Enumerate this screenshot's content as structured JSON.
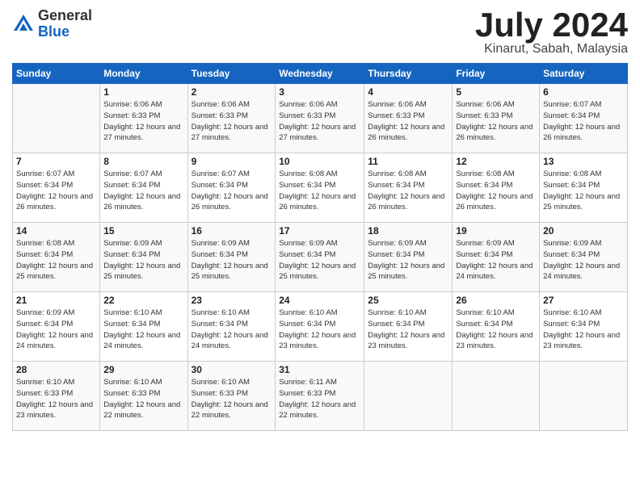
{
  "header": {
    "logo_general": "General",
    "logo_blue": "Blue",
    "month_title": "July 2024",
    "location": "Kinarut, Sabah, Malaysia"
  },
  "weekdays": [
    "Sunday",
    "Monday",
    "Tuesday",
    "Wednesday",
    "Thursday",
    "Friday",
    "Saturday"
  ],
  "weeks": [
    [
      {
        "day": "",
        "sunrise": "",
        "sunset": "",
        "daylight": ""
      },
      {
        "day": "1",
        "sunrise": "Sunrise: 6:06 AM",
        "sunset": "Sunset: 6:33 PM",
        "daylight": "Daylight: 12 hours and 27 minutes."
      },
      {
        "day": "2",
        "sunrise": "Sunrise: 6:06 AM",
        "sunset": "Sunset: 6:33 PM",
        "daylight": "Daylight: 12 hours and 27 minutes."
      },
      {
        "day": "3",
        "sunrise": "Sunrise: 6:06 AM",
        "sunset": "Sunset: 6:33 PM",
        "daylight": "Daylight: 12 hours and 27 minutes."
      },
      {
        "day": "4",
        "sunrise": "Sunrise: 6:06 AM",
        "sunset": "Sunset: 6:33 PM",
        "daylight": "Daylight: 12 hours and 26 minutes."
      },
      {
        "day": "5",
        "sunrise": "Sunrise: 6:06 AM",
        "sunset": "Sunset: 6:33 PM",
        "daylight": "Daylight: 12 hours and 26 minutes."
      },
      {
        "day": "6",
        "sunrise": "Sunrise: 6:07 AM",
        "sunset": "Sunset: 6:34 PM",
        "daylight": "Daylight: 12 hours and 26 minutes."
      }
    ],
    [
      {
        "day": "7",
        "sunrise": "Sunrise: 6:07 AM",
        "sunset": "Sunset: 6:34 PM",
        "daylight": "Daylight: 12 hours and 26 minutes."
      },
      {
        "day": "8",
        "sunrise": "Sunrise: 6:07 AM",
        "sunset": "Sunset: 6:34 PM",
        "daylight": "Daylight: 12 hours and 26 minutes."
      },
      {
        "day": "9",
        "sunrise": "Sunrise: 6:07 AM",
        "sunset": "Sunset: 6:34 PM",
        "daylight": "Daylight: 12 hours and 26 minutes."
      },
      {
        "day": "10",
        "sunrise": "Sunrise: 6:08 AM",
        "sunset": "Sunset: 6:34 PM",
        "daylight": "Daylight: 12 hours and 26 minutes."
      },
      {
        "day": "11",
        "sunrise": "Sunrise: 6:08 AM",
        "sunset": "Sunset: 6:34 PM",
        "daylight": "Daylight: 12 hours and 26 minutes."
      },
      {
        "day": "12",
        "sunrise": "Sunrise: 6:08 AM",
        "sunset": "Sunset: 6:34 PM",
        "daylight": "Daylight: 12 hours and 26 minutes."
      },
      {
        "day": "13",
        "sunrise": "Sunrise: 6:08 AM",
        "sunset": "Sunset: 6:34 PM",
        "daylight": "Daylight: 12 hours and 25 minutes."
      }
    ],
    [
      {
        "day": "14",
        "sunrise": "Sunrise: 6:08 AM",
        "sunset": "Sunset: 6:34 PM",
        "daylight": "Daylight: 12 hours and 25 minutes."
      },
      {
        "day": "15",
        "sunrise": "Sunrise: 6:09 AM",
        "sunset": "Sunset: 6:34 PM",
        "daylight": "Daylight: 12 hours and 25 minutes."
      },
      {
        "day": "16",
        "sunrise": "Sunrise: 6:09 AM",
        "sunset": "Sunset: 6:34 PM",
        "daylight": "Daylight: 12 hours and 25 minutes."
      },
      {
        "day": "17",
        "sunrise": "Sunrise: 6:09 AM",
        "sunset": "Sunset: 6:34 PM",
        "daylight": "Daylight: 12 hours and 25 minutes."
      },
      {
        "day": "18",
        "sunrise": "Sunrise: 6:09 AM",
        "sunset": "Sunset: 6:34 PM",
        "daylight": "Daylight: 12 hours and 25 minutes."
      },
      {
        "day": "19",
        "sunrise": "Sunrise: 6:09 AM",
        "sunset": "Sunset: 6:34 PM",
        "daylight": "Daylight: 12 hours and 24 minutes."
      },
      {
        "day": "20",
        "sunrise": "Sunrise: 6:09 AM",
        "sunset": "Sunset: 6:34 PM",
        "daylight": "Daylight: 12 hours and 24 minutes."
      }
    ],
    [
      {
        "day": "21",
        "sunrise": "Sunrise: 6:09 AM",
        "sunset": "Sunset: 6:34 PM",
        "daylight": "Daylight: 12 hours and 24 minutes."
      },
      {
        "day": "22",
        "sunrise": "Sunrise: 6:10 AM",
        "sunset": "Sunset: 6:34 PM",
        "daylight": "Daylight: 12 hours and 24 minutes."
      },
      {
        "day": "23",
        "sunrise": "Sunrise: 6:10 AM",
        "sunset": "Sunset: 6:34 PM",
        "daylight": "Daylight: 12 hours and 24 minutes."
      },
      {
        "day": "24",
        "sunrise": "Sunrise: 6:10 AM",
        "sunset": "Sunset: 6:34 PM",
        "daylight": "Daylight: 12 hours and 23 minutes."
      },
      {
        "day": "25",
        "sunrise": "Sunrise: 6:10 AM",
        "sunset": "Sunset: 6:34 PM",
        "daylight": "Daylight: 12 hours and 23 minutes."
      },
      {
        "day": "26",
        "sunrise": "Sunrise: 6:10 AM",
        "sunset": "Sunset: 6:34 PM",
        "daylight": "Daylight: 12 hours and 23 minutes."
      },
      {
        "day": "27",
        "sunrise": "Sunrise: 6:10 AM",
        "sunset": "Sunset: 6:34 PM",
        "daylight": "Daylight: 12 hours and 23 minutes."
      }
    ],
    [
      {
        "day": "28",
        "sunrise": "Sunrise: 6:10 AM",
        "sunset": "Sunset: 6:33 PM",
        "daylight": "Daylight: 12 hours and 23 minutes."
      },
      {
        "day": "29",
        "sunrise": "Sunrise: 6:10 AM",
        "sunset": "Sunset: 6:33 PM",
        "daylight": "Daylight: 12 hours and 22 minutes."
      },
      {
        "day": "30",
        "sunrise": "Sunrise: 6:10 AM",
        "sunset": "Sunset: 6:33 PM",
        "daylight": "Daylight: 12 hours and 22 minutes."
      },
      {
        "day": "31",
        "sunrise": "Sunrise: 6:11 AM",
        "sunset": "Sunset: 6:33 PM",
        "daylight": "Daylight: 12 hours and 22 minutes."
      },
      {
        "day": "",
        "sunrise": "",
        "sunset": "",
        "daylight": ""
      },
      {
        "day": "",
        "sunrise": "",
        "sunset": "",
        "daylight": ""
      },
      {
        "day": "",
        "sunrise": "",
        "sunset": "",
        "daylight": ""
      }
    ]
  ]
}
